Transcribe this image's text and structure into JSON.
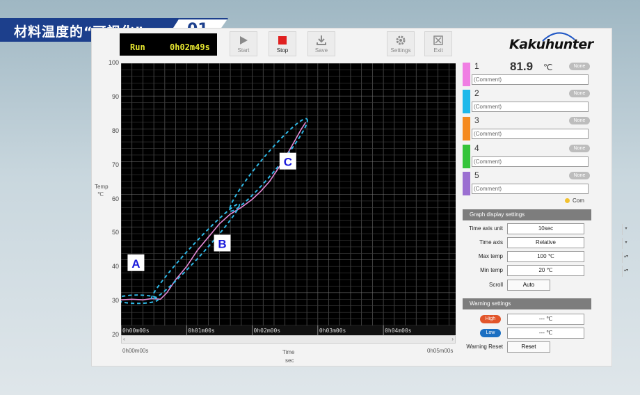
{
  "banner": {
    "title": "材料温度的“可视化”",
    "number": "01"
  },
  "status": {
    "state": "Run",
    "elapsed": "0h02m49s"
  },
  "toolbar": {
    "start": "Start",
    "stop": "Stop",
    "save": "Save",
    "settings": "Settings",
    "exit": "Exit"
  },
  "brand": {
    "logo": "Kakuhunter"
  },
  "chart_data": {
    "type": "line",
    "ylabel": "Temp",
    "yunit": "℃",
    "xlabel": "Time",
    "xunit": "sec",
    "ylim": [
      20,
      100
    ],
    "yticks": [
      "100",
      "90",
      "80",
      "70",
      "60",
      "50",
      "40",
      "30",
      "20"
    ],
    "xticks": [
      "0h00m00s",
      "0h01m00s",
      "0h02m00s",
      "0h03m00s",
      "0h04m00s"
    ],
    "x_range_labels": [
      "0h00m00s",
      "0h05m00s"
    ],
    "series": [
      {
        "name": "1",
        "color": "#e58ad6",
        "x": [
          0,
          10,
          20,
          28,
          36,
          42,
          50,
          60,
          70,
          80,
          90,
          100,
          110,
          120,
          128,
          136,
          142,
          148,
          155,
          160,
          165,
          169
        ],
        "y": [
          27.8,
          28,
          27.8,
          28.2,
          28,
          30,
          34,
          38,
          43,
          47,
          51,
          54,
          56,
          58.5,
          61,
          64,
          67,
          70,
          74,
          77,
          80,
          82
        ]
      }
    ],
    "annotations": [
      {
        "label": "A",
        "color": "#1a1adb"
      },
      {
        "label": "B",
        "color": "#1a1adb"
      },
      {
        "label": "C",
        "color": "#1a1adb"
      }
    ],
    "grid": true,
    "background": "#000000"
  },
  "channels": [
    {
      "num": "1",
      "value": "81.9",
      "unit": "℃",
      "badge": "None",
      "comment": "(Comment)",
      "color": "#f07ee3"
    },
    {
      "num": "2",
      "value": "",
      "unit": "",
      "badge": "None",
      "comment": "(Comment)",
      "color": "#1eb8ea"
    },
    {
      "num": "3",
      "value": "",
      "unit": "",
      "badge": "None",
      "comment": "(Comment)",
      "color": "#f58a1f"
    },
    {
      "num": "4",
      "value": "",
      "unit": "",
      "badge": "None",
      "comment": "(Comment)",
      "color": "#35c43a"
    },
    {
      "num": "5",
      "value": "",
      "unit": "",
      "badge": "None",
      "comment": "(Comment)",
      "color": "#9b6fd1"
    }
  ],
  "legend_com": "Com",
  "graph_settings": {
    "header": "Graph display settings",
    "time_axis_unit_label": "Time axis unit",
    "time_axis_unit": "10sec",
    "time_axis_label": "Time axis",
    "time_axis": "Relative",
    "max_temp_label": "Max temp",
    "max_temp": "100  ℃",
    "min_temp_label": "Min temp",
    "min_temp": "20  ℃",
    "scroll_label": "Scroll",
    "scroll_value": "Auto"
  },
  "warning_settings": {
    "header": "Warning settings",
    "high_label": "High",
    "high_value": "---  ℃",
    "low_label": "Low",
    "low_value": "---  ℃",
    "reset_label": "Warning Reset",
    "reset_button": "Reset"
  }
}
